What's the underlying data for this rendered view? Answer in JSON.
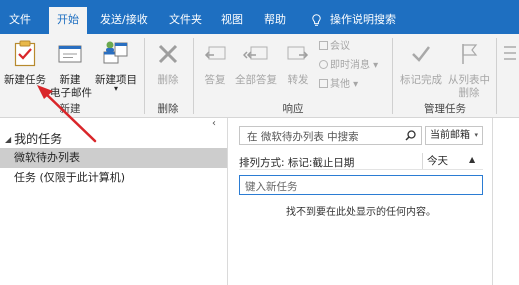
{
  "colors": {
    "accent": "#1e6fc1",
    "arrow": "#d9262a",
    "ribbon_bg": "#f3f3f3",
    "selected_bg": "#cdcdcd"
  },
  "menu": {
    "file": "文件",
    "home": "开始",
    "send_receive": "发送/接收",
    "folder": "文件夹",
    "view": "视图",
    "help": "帮助",
    "tell_me": "操作说明搜索"
  },
  "ribbon": {
    "new_task": "新建任务",
    "new_email_line1": "新建",
    "new_email_line2": "电子邮件",
    "new_items_line1": "新建项目",
    "new_items_arrow": "▾",
    "group_new": "新建",
    "delete": "删除",
    "group_delete": "删除",
    "reply": "答复",
    "reply_all": "全部答复",
    "forward": "转发",
    "meeting": "会议",
    "im": "即时消息 ▾",
    "more": "其他 ▾",
    "group_respond": "响应",
    "mark_complete": "标记完成",
    "remove_line1": "从列表中",
    "remove_line2": "删除",
    "group_manage": "管理任务"
  },
  "nav": {
    "my_tasks": "我的任务",
    "todo_list": "微软待办列表",
    "tasks_local": "任务 (仅限于此计算机)",
    "collapse": "‹"
  },
  "pane": {
    "search_placeholder": "在 微软待办列表 中搜索",
    "scope": "当前邮箱",
    "sort_label": "排列方式: 标记:截止日期",
    "sort_col": "今天",
    "new_task_placeholder": "键入新任务",
    "empty_message": "找不到要在此处显示的任何内容。"
  },
  "icons": [
    "lightbulb-icon",
    "new-task-icon",
    "new-email-icon",
    "new-items-icon",
    "delete-icon",
    "reply-icon",
    "reply-all-icon",
    "forward-icon",
    "meeting-icon",
    "im-icon",
    "more-icon",
    "checkmark-icon",
    "flag-remove-icon",
    "search-icon",
    "annotation-arrow"
  ]
}
